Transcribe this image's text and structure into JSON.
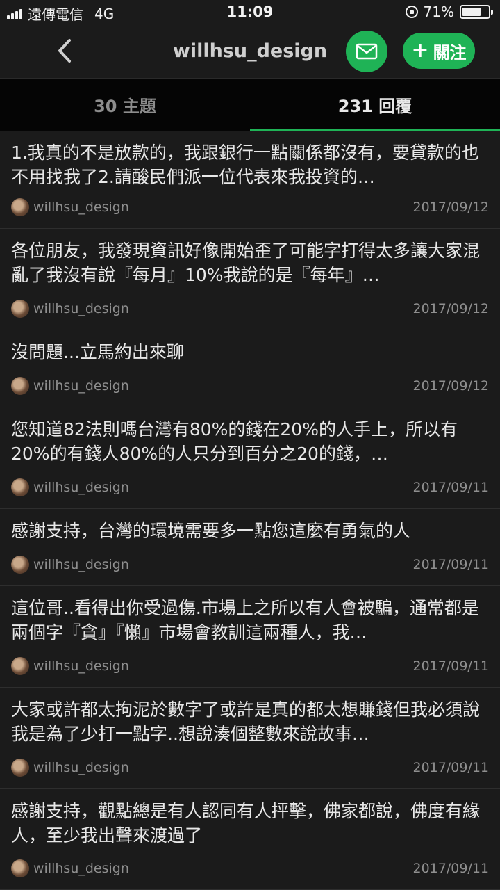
{
  "status_bar": {
    "carrier": "遠傳電信",
    "network": "4G",
    "time": "11:09",
    "battery": "71%",
    "battery_level": 0.71
  },
  "nav": {
    "title": "willhsu_design",
    "follow_label": "關注",
    "accent_color": "#1fb356"
  },
  "tabs": [
    {
      "label": "30 主題"
    },
    {
      "label": "231 回覆"
    }
  ],
  "replies": [
    {
      "text": "1.我真的不是放款的，我跟銀行一點關係都沒有，要貸款的也不用找我了2.請酸民們派一位代表來我投資的…",
      "author": "willhsu_design",
      "date": "2017/09/12"
    },
    {
      "text": "各位朋友，我發現資訊好像開始歪了可能字打得太多讓大家混亂了我沒有說『每月』10%我說的是『每年』…",
      "author": "willhsu_design",
      "date": "2017/09/12"
    },
    {
      "text": "沒問題...立馬約出來聊",
      "author": "willhsu_design",
      "date": "2017/09/12"
    },
    {
      "text": "您知道82法則嗎台灣有80%的錢在20%的人手上，所以有20%的有錢人80%的人只分到百分之20的錢，…",
      "author": "willhsu_design",
      "date": "2017/09/11"
    },
    {
      "text": "感謝支持，台灣的環境需要多一點您這麼有勇氣的人",
      "author": "willhsu_design",
      "date": "2017/09/11"
    },
    {
      "text": "這位哥..看得出你受過傷.市場上之所以有人會被騙，通常都是兩個字『貪』『懶』市場會教訓這兩種人，我…",
      "author": "willhsu_design",
      "date": "2017/09/11"
    },
    {
      "text": "大家或許都太拘泥於數字了或許是真的都太想賺錢但我必須說我是為了少打一點字..想說湊個整數來說故事…",
      "author": "willhsu_design",
      "date": "2017/09/11"
    },
    {
      "text": "感謝支持，觀點總是有人認同有人抨擊，佛家都說，佛度有緣人，至少我出聲來渡過了",
      "author": "willhsu_design",
      "date": "2017/09/11"
    }
  ]
}
